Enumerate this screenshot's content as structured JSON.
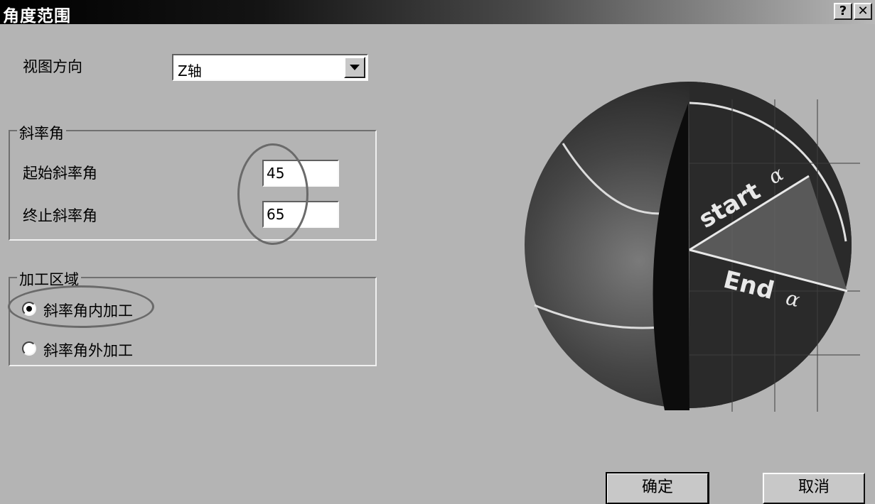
{
  "window": {
    "title": "角度范围",
    "help_button": "?",
    "close_button": "✕"
  },
  "view_direction": {
    "label": "视图方向",
    "selected": "Z轴"
  },
  "slope_group": {
    "title": "斜率角",
    "start_label": "起始斜率角",
    "start_value": "45",
    "end_label": "终止斜率角",
    "end_value": "65"
  },
  "machining_group": {
    "title": "加工区域",
    "options": [
      {
        "label": "斜率角内加工",
        "selected": true
      },
      {
        "label": "斜率角外加工",
        "selected": false
      }
    ]
  },
  "diagram": {
    "start_text": "start",
    "end_text": "End",
    "alpha": "α"
  },
  "buttons": {
    "ok": "确定",
    "cancel": "取消"
  },
  "icons": {
    "dropdown": "chevron-down-icon",
    "help": "help-icon",
    "close": "close-icon"
  }
}
